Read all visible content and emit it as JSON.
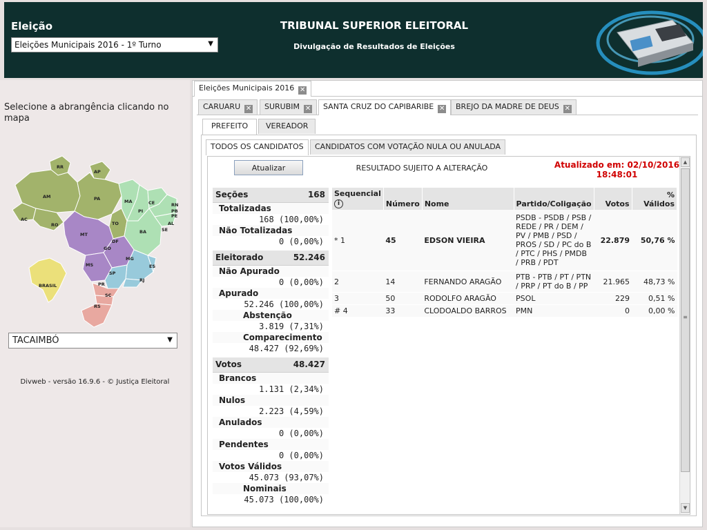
{
  "header": {
    "election_label": "Eleição",
    "election_select": "Eleições Municipais 2016 - 1º Turno",
    "title": "TRIBUNAL SUPERIOR ELEITORAL",
    "subtitle": "Divulgação de Resultados de Eleições"
  },
  "left": {
    "select_hint": "Selecione a abrangência clicando no mapa",
    "map_labels": {
      "RR": "RR",
      "AP": "AP",
      "AM": "AM",
      "PA": "PA",
      "MA": "MA",
      "CE": "CE",
      "RN": "RN",
      "PB": "PB",
      "PE": "PE",
      "AL": "AL",
      "SE": "SE",
      "PI": "PI",
      "AC": "AC",
      "RO": "RO",
      "TO": "TO",
      "BA": "BA",
      "MT": "MT",
      "DF": "DF",
      "GO": "GO",
      "MG": "MG",
      "ES": "ES",
      "MS": "MS",
      "SP": "SP",
      "RJ": "RJ",
      "PR": "PR",
      "SC": "SC",
      "RS": "RS",
      "BRASIL": "BRASIL"
    },
    "municipio_select": "TACAIMBÓ",
    "footer": "Divweb - versão 16.9.6 - © Justiça Eleitoral"
  },
  "tabs": {
    "election_tab": "Eleições Municipais 2016",
    "municipio_tabs": [
      "CARUARU",
      "SURUBIM",
      "SANTA CRUZ DO CAPIBARIBE",
      "BREJO DA MADRE DE DEUS"
    ],
    "cargo_tabs": [
      "PREFEITO",
      "VEREADOR"
    ],
    "view_tabs": [
      "TODOS OS CANDIDATOS",
      "CANDIDATOS COM VOTAÇÃO NULA OU ANULADA"
    ],
    "close_glyph": "✕"
  },
  "toolbar": {
    "update_label": "Atualizar",
    "notice": "RESULTADO SUJEITO A ALTERAÇÃO",
    "updated_at_line1": "Atualizado em: 02/10/2016",
    "updated_at_line2": "18:48:01"
  },
  "stats": {
    "secoes_label": "Seções",
    "secoes_value": "168",
    "totalizadas_label": "Totalizadas",
    "totalizadas_value": "168 (100,00%)",
    "nao_totalizadas_label": "Não Totalizadas",
    "nao_totalizadas_value": "0 (0,00%)",
    "eleitorado_label": "Eleitorado",
    "eleitorado_value": "52.246",
    "nao_apurado_label": "Não Apurado",
    "nao_apurado_value": "0 (0,00%)",
    "apurado_label": "Apurado",
    "apurado_value": "52.246 (100,00%)",
    "abstencao_label": "Abstenção",
    "abstencao_value": "3.819 (7,31%)",
    "comparecimento_label": "Comparecimento",
    "comparecimento_value": "48.427 (92,69%)",
    "votos_label": "Votos",
    "votos_value": "48.427",
    "brancos_label": "Brancos",
    "brancos_value": "1.131 (2,34%)",
    "nulos_label": "Nulos",
    "nulos_value": "2.223 (4,59%)",
    "anulados_label": "Anulados",
    "anulados_value": "0 (0,00%)",
    "pendentes_label": "Pendentes",
    "pendentes_value": "0 (0,00%)",
    "validos_label": "Votos Válidos",
    "validos_value": "45.073 (93,07%)",
    "nominais_label": "Nominais",
    "nominais_value": "45.073 (100,00%)"
  },
  "table": {
    "headers": {
      "seq": "Sequencial",
      "numero": "Número",
      "nome": "Nome",
      "partido": "Partido/Coligação",
      "votos": "Votos",
      "validos": "% Válidos"
    },
    "info_glyph": "i",
    "rows": [
      {
        "seq": "* 1",
        "numero": "45",
        "nome": "EDSON VIEIRA",
        "partido": "PSDB - PSDB / PSB / REDE / PR / DEM / PV / PMB / PSD / PROS / SD / PC do B / PTC / PHS / PMDB / PRB / PDT",
        "votos": "22.879",
        "validos": "50,76 %",
        "bold": true
      },
      {
        "seq": "2",
        "numero": "14",
        "nome": "FERNANDO ARAGÃO",
        "partido": "PTB - PTB / PT / PTN / PRP / PT do B / PP",
        "votos": "21.965",
        "validos": "48,73 %",
        "bold": false
      },
      {
        "seq": "3",
        "numero": "50",
        "nome": "RODOLFO ARAGÃO",
        "partido": "PSOL",
        "votos": "229",
        "validos": "0,51 %",
        "bold": false
      },
      {
        "seq": "# 4",
        "numero": "33",
        "nome": "CLODOALDO BARROS",
        "partido": "PMN",
        "votos": "0",
        "validos": "0,00 %",
        "bold": false
      }
    ]
  },
  "colors": {
    "header_bg": "#0e2f2e",
    "updated_red": "#d00000",
    "region_north": "#a2b36b",
    "region_northeast": "#aee0b4",
    "region_centerwest": "#a887c6",
    "region_southeast": "#98cadb",
    "region_south": "#e8a8a0",
    "brasil": "#ebe07a"
  }
}
